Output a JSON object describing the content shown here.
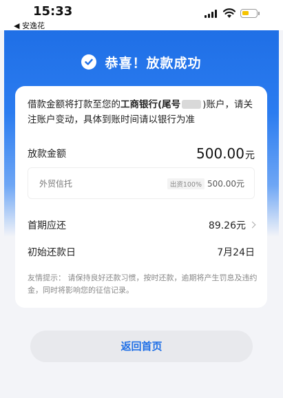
{
  "status_bar": {
    "time": "15:33",
    "back_app": "◀ 安逸花"
  },
  "header": {
    "title": "恭喜！放款成功"
  },
  "notice": {
    "prefix": "借款金额将打款至您的",
    "bank": "工商银行(尾号",
    "suffix": ")账户，请关注账户变动，具体到账时间请以银行为准"
  },
  "loan": {
    "label": "放款金额",
    "amount": "500.00",
    "unit": "元"
  },
  "funding": {
    "name": "外贸信托",
    "ratio": "出资100%",
    "amount": "500.00元"
  },
  "first_payment": {
    "label": "首期应还",
    "value": "89.26元"
  },
  "first_date": {
    "label": "初始还款日",
    "value": "7月24日"
  },
  "tip": {
    "text": "友情提示： 请保持良好还款习惯，按时还款，逾期将产生罚息及违约金，同时将影响您的征信记录。"
  },
  "footer": {
    "button_label": "返回首页"
  },
  "colors": {
    "brand_blue": "#1f6fe6",
    "battery_yellow": "#f6c400"
  }
}
